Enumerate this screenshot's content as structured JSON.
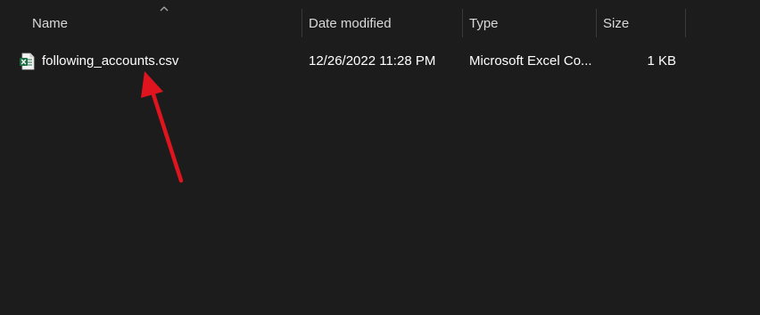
{
  "columns": {
    "name": "Name",
    "date_modified": "Date modified",
    "type": "Type",
    "size": "Size"
  },
  "sort": {
    "column": "name",
    "direction": "ascending",
    "icon": "chevron-up-icon"
  },
  "files": [
    {
      "icon": "excel-csv-file-icon",
      "name": "following_accounts.csv",
      "date_modified": "12/26/2022 11:28 PM",
      "type": "Microsoft Excel Co...",
      "size": "1 KB"
    }
  ],
  "annotation": {
    "kind": "arrow",
    "color": "#e0141e",
    "points_to": "following_accounts.csv"
  },
  "colors": {
    "background": "#1c1c1c",
    "header_text": "#d9d9d9",
    "divider": "#3a3a3a",
    "excel_green": "#1e7145"
  }
}
